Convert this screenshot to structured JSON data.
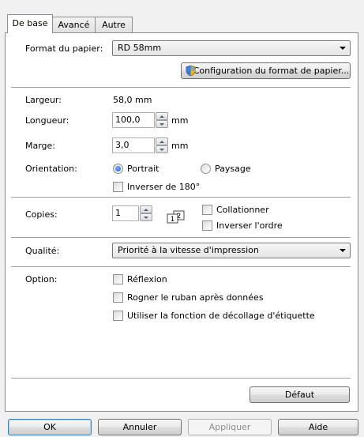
{
  "tabs": [
    {
      "label": "De base",
      "active": true
    },
    {
      "label": "Avancé",
      "active": false
    },
    {
      "label": "Autre",
      "active": false
    }
  ],
  "paper": {
    "label": "Format du papier:",
    "value": "RD 58mm",
    "config_button": "Configuration du format de papier..."
  },
  "dimensions": {
    "width_label": "Largeur:",
    "width_value": "58,0 mm",
    "length_label": "Longueur:",
    "length_value": "100,0",
    "length_unit": "mm",
    "margin_label": "Marge:",
    "margin_value": "3,0",
    "margin_unit": "mm"
  },
  "orientation": {
    "label": "Orientation:",
    "portrait": "Portrait",
    "landscape": "Paysage",
    "selected": "portrait",
    "rotate180": "Inverser de 180°"
  },
  "copies": {
    "label": "Copies:",
    "value": "1",
    "collate": "Collationner",
    "reverse": "Inverser l'ordre"
  },
  "quality": {
    "label": "Qualité:",
    "value": "Priorité à la vitesse d'impression"
  },
  "options": {
    "label": "Option:",
    "mirror": "Réflexion",
    "trim": "Rogner le ruban après données",
    "peel": "Utiliser la fonction de décollage d'étiquette"
  },
  "default_button": "Défaut",
  "footer": {
    "ok": "OK",
    "cancel": "Annuler",
    "apply": "Appliquer",
    "help": "Aide"
  },
  "colors": {
    "accent": "#1c5cc7",
    "panel_border": "#898c95"
  }
}
